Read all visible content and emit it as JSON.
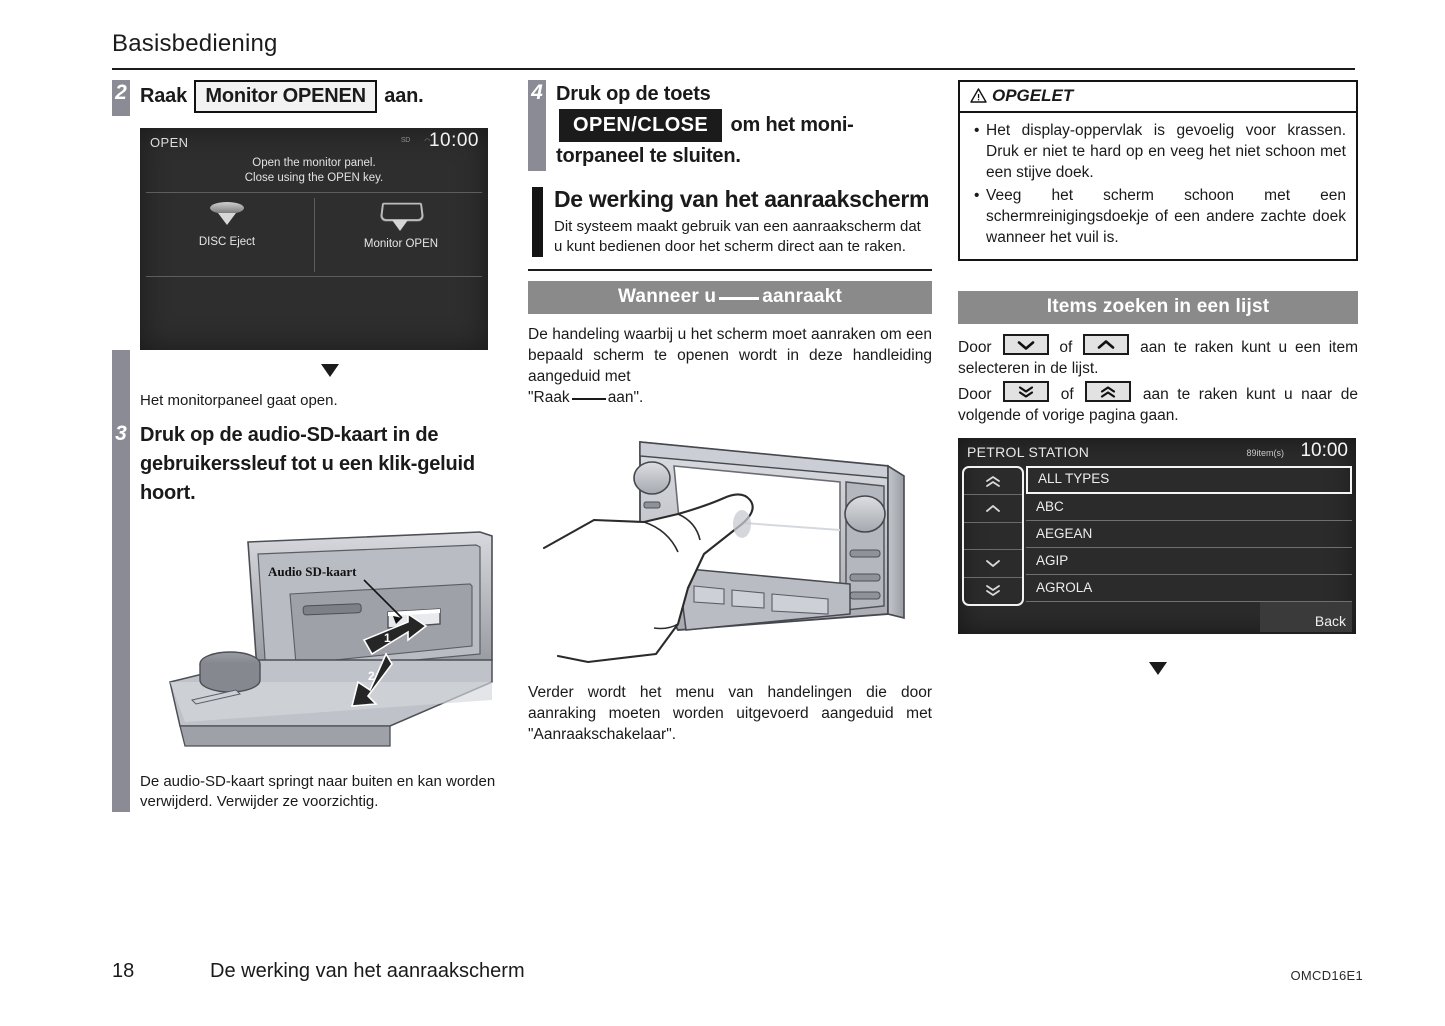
{
  "header": {
    "title": "Basisbediening"
  },
  "footer": {
    "page_number": "18",
    "section": "De werking van het aanraakscherm",
    "doc_code": "OMCD16E1"
  },
  "column_left": {
    "step2": {
      "number": "2",
      "text_before": "Raak",
      "button_label": "Monitor OPENEN",
      "text_after": "aan."
    },
    "open_screen": {
      "title": "OPEN",
      "clock": "10:00",
      "status_icon_1": "sd-card-icon",
      "status_icon_2": "disc-icon",
      "message_line1": "Open the monitor panel.",
      "message_line2": "Close using the OPEN key.",
      "button_left": "DISC Eject",
      "button_right": "Monitor OPEN"
    },
    "after_marker": "triangle-down",
    "result_text": "Het monitorpaneel gaat open.",
    "step3": {
      "number": "3",
      "text": "Druk op de audio-SD-kaart in de gebruikerssleuf tot u een klik-geluid hoort."
    },
    "illustration_label": "Audio SD-kaart",
    "illustration_callout_1": "1",
    "illustration_callout_2": "2",
    "caption": "De audio-SD-kaart springt naar buiten en kan worden verwijderd. Verwijder ze voorzichtig."
  },
  "column_middle": {
    "step4": {
      "number": "4",
      "line1": "Druk op de toets",
      "key_label": "OPEN/CLOSE",
      "line2_after_key": "om het moni-",
      "line3": "torpaneel te sluiten."
    },
    "section": {
      "title": "De werking van het aanraakscherm",
      "body": "Dit systeem maakt gebruik van een aanraakscherm dat u kunt bedienen door het scherm direct aan te raken."
    },
    "band": {
      "before": "Wanneer u",
      "blank": "",
      "after": "aanraakt"
    },
    "body_1a": "De handeling waarbij u het scherm moet aanraken om een bepaald scherm te openen wordt in deze handleiding aangeduid met",
    "body_1b_before": "\"Raak",
    "body_1b_after": "aan\".",
    "illustration_name": "hand-touching-screen",
    "body_2": "Verder wordt het menu van handelingen die door aanraking moeten worden uitgevoerd aangeduid met \"Aanraakschakelaar\"."
  },
  "column_right": {
    "warning": {
      "title": "OPGELET",
      "items": [
        "Het display-oppervlak is gevoelig voor krassen. Druk er niet te hard op en veeg het niet schoon met een stijve doek.",
        "Veeg het scherm schoon met een schermreinigingsdoekje of een andere zachte doek wanneer het vuil is."
      ]
    },
    "band": "Items zoeken in een lijst",
    "list_text": {
      "line1_a": "Door",
      "line1_b": "of",
      "line1_c": "aan te raken kunt u een item selecteren in de lijst.",
      "line2_a": "Door",
      "line2_b": "of",
      "line2_c": "aan te raken kunt u naar de volgende of vorige pagina gaan.",
      "key1": "chevron-down-icon",
      "key2": "chevron-up-icon",
      "key3": "double-chevron-down-icon",
      "key4": "double-chevron-up-icon"
    },
    "list_screen": {
      "title": "PETROL STATION",
      "count": "89item(s)",
      "clock": "10:00",
      "rows": [
        "ALL TYPES",
        "ABC",
        "AEGEAN",
        "AGIP",
        "AGROLA"
      ],
      "back_label": "Back",
      "side_buttons": [
        "double-chevron-up-icon",
        "chevron-up-icon",
        "",
        "chevron-down-icon",
        "double-chevron-down-icon"
      ]
    },
    "after_marker": "triangle-down"
  }
}
